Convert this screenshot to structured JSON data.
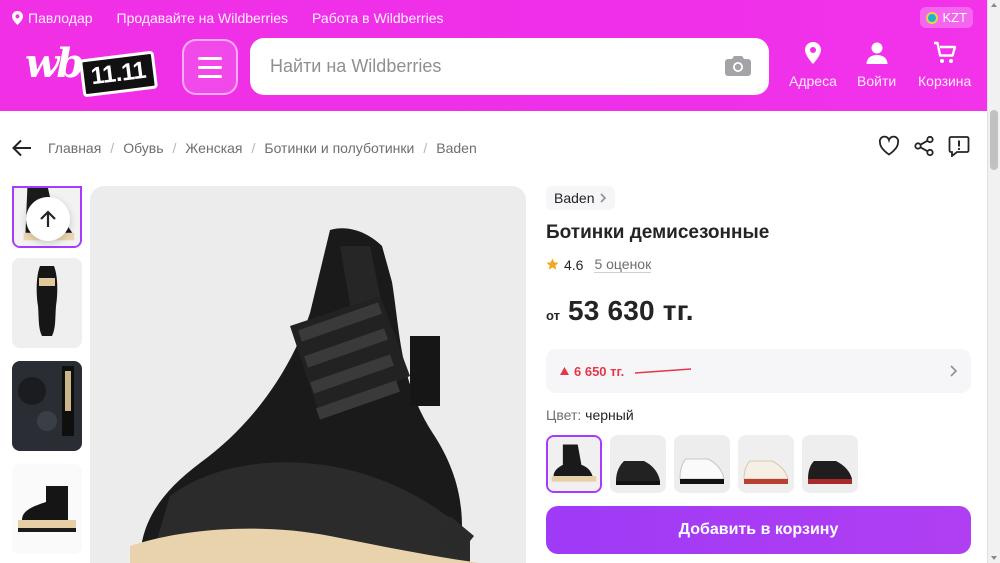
{
  "header": {
    "location": "Павлодар",
    "links": [
      "Продавайте на Wildberries",
      "Работа в Wildberries"
    ],
    "currency": "KZT",
    "logo_text": "wb",
    "promo_text": "11.11",
    "search_placeholder": "Найти на Wildberries",
    "nav": [
      {
        "label": "Адреса",
        "icon": "location-pin-icon"
      },
      {
        "label": "Войти",
        "icon": "user-icon"
      },
      {
        "label": "Корзина",
        "icon": "cart-icon"
      }
    ]
  },
  "breadcrumbs": [
    "Главная",
    "Обувь",
    "Женская",
    "Ботинки и полуботинки",
    "Baden"
  ],
  "product": {
    "brand": "Baden",
    "title": "Ботинки демисезонные",
    "rating": "4.6",
    "reviews": "5 оценок",
    "price_prefix": "от",
    "price": "53 630 тг.",
    "price_change": "6 650 тг.",
    "color_label": "Цвет:",
    "color_value": "черный",
    "add_to_cart": "Добавить в корзину"
  },
  "colors": {
    "brand_primary": "#f02fe8",
    "accent_purple": "#a73afd",
    "price_up_red": "#e5374a"
  }
}
